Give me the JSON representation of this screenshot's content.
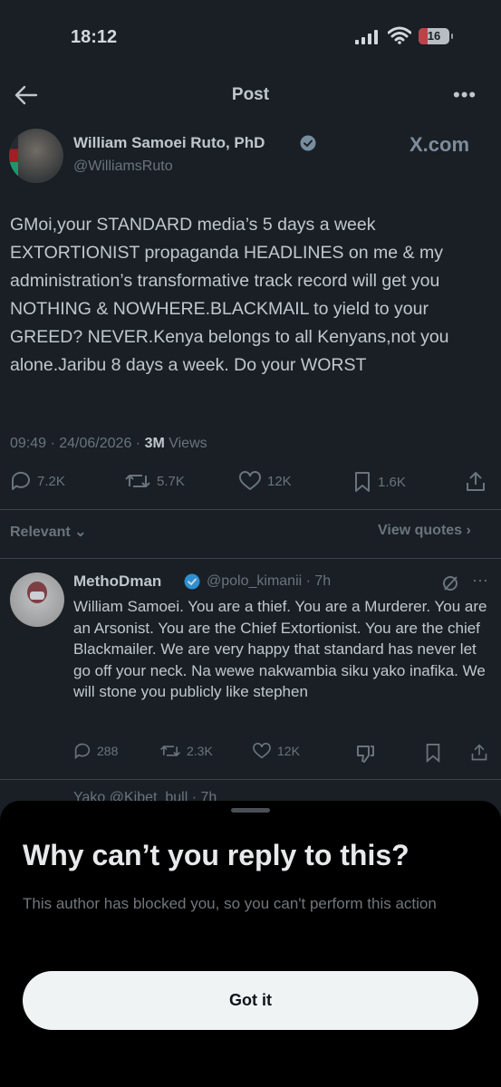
{
  "status_bar": {
    "time": "18:12",
    "battery": "16",
    "battery_level": 0.16,
    "battery_color": "#e03333"
  },
  "header": {
    "title": "Post"
  },
  "post": {
    "author_name": "William Samoei Ruto, PhD",
    "author_handle": "@WilliamsRuto",
    "source_logo": "X.com",
    "text": "GMoi,your STANDARD media’s 5 days a week EXTORTIONIST propaganda HEADLINES on me & my administration’s transformative track record will get you NOTHING & NOWHERE.BLACKMAIL to yield to your GREED? NEVER.Kenya belongs to all Kenyans,not you alone.Jaribu 8 days a week. Do your WORST",
    "timestamp": "09:49 · 24/06/2026 · ",
    "views_count": "3M",
    "views_label": " Views",
    "replies": "7.2K",
    "reposts": "5.7K",
    "likes": "12K",
    "bookmarks": "1.6K"
  },
  "sort": {
    "relevant_label": "Relevant",
    "view_quotes_label": "View quotes"
  },
  "reply": {
    "author_name": "MethoDman",
    "author_handle": "@polo_kimanii · 7h",
    "text": "William Samoei. You are a thief. You are a Murderer. You are an Arsonist. You are the Chief Extortionist. You are the chief Blackmailer. We are very happy that standard has never let go off your neck. Na wewe nakwambia siku yako inafika. We will stone you publicly like stephen",
    "replies": "288",
    "reposts": "2.3K",
    "likes": "12K"
  },
  "next_reply_peek": "Yako  @Kibet_bull · 7h",
  "sheet": {
    "title": "Why can’t you reply to this?",
    "body": "This author has blocked you, so you can't perform this action",
    "button_label": "Got it"
  },
  "colors": {
    "accent_verified": "#1d9bf0",
    "muted": "#71767b",
    "button_bg": "#eff3f4"
  },
  "icons": [
    "back-arrow-icon",
    "more-icon",
    "verified-icon",
    "reply-icon",
    "repost-icon",
    "like-icon",
    "bookmark-icon",
    "share-icon",
    "grok-icon",
    "dislike-icon",
    "chevron-down-icon",
    "chevron-right-icon"
  ]
}
